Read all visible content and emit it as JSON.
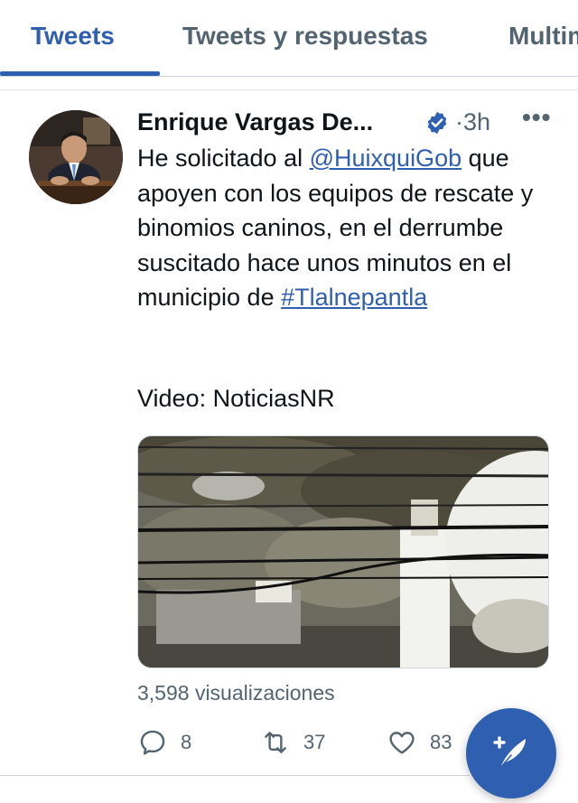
{
  "tabs": [
    {
      "label": "Tweets",
      "active": true
    },
    {
      "label": "Tweets y respuestas",
      "active": false
    },
    {
      "label": "Multimedia",
      "active": false
    }
  ],
  "tweet": {
    "author": "Enrique Vargas De...",
    "verified": true,
    "separator": "·",
    "time": "3h",
    "more_icon": "more-horizontal-icon",
    "text_before_mention": "He solicitado al ",
    "mention": "@HuixquiGob",
    "text_after_mention": " que apoyen con los equipos de rescate y binomios caninos, en el derrumbe suscitado hace unos minutos en el municipio de ",
    "hashtag": "#Tlalnepantla",
    "video_credit": "Video: NoticiasNR",
    "views": "3,598 visualizaciones",
    "actions": {
      "reply_count": "8",
      "retweet_count": "37",
      "like_count": "83"
    }
  },
  "fab": {
    "icon": "compose-tweet-icon"
  },
  "colors": {
    "accent": "#2f5fb0",
    "text": "#0f1419",
    "secondary": "#536471",
    "border": "#cfd9de"
  }
}
